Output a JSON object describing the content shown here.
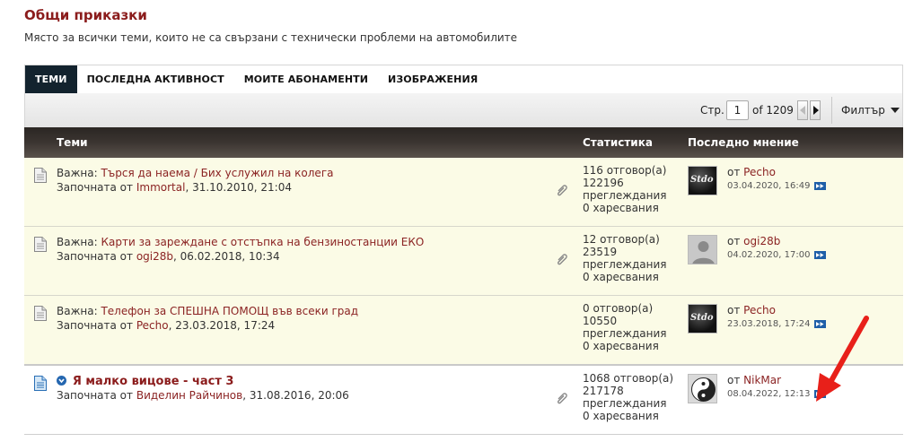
{
  "forum": {
    "title": "Общи приказки",
    "description": "Място за всички теми, които не са свързани с технически проблеми на автомобилите"
  },
  "tabs": [
    {
      "label": "ТЕМИ",
      "active": true
    },
    {
      "label": "ПОСЛЕДНА АКТИВНОСТ",
      "active": false
    },
    {
      "label": "МОИТЕ АБОНАМЕНТИ",
      "active": false
    },
    {
      "label": "ИЗОБРАЖЕНИЯ",
      "active": false
    }
  ],
  "pager": {
    "label": "Стр.",
    "current": "1",
    "total": "of 1209",
    "filter_label": "Филтър"
  },
  "table_header": {
    "topics": "Теми",
    "stats": "Статистика",
    "last_post": "Последно мнение"
  },
  "threads": [
    {
      "prefix": "Важна:",
      "title": "Търся да наема / Бих услужил на колега",
      "started_by_label": "Започната от",
      "author": "Immortal",
      "started_date": ", 31.10.2010, 21:04",
      "replies": "116 отговор(а)",
      "views_count": "122196",
      "views_label": "преглеждания",
      "likes": "0 харесвания",
      "last_by_label": "от",
      "last_user": "Pecho",
      "last_date": "03.04.2020, 16:49",
      "avatar": "stdo"
    },
    {
      "prefix": "Важна:",
      "title": "Карти за зареждане с отстъпка на бензиностанции ЕКО",
      "started_by_label": "Започната от",
      "author": "ogi28b",
      "started_date": ", 06.02.2018, 10:34",
      "replies": "12 отговор(а)",
      "views_count": "23519",
      "views_label": "преглеждания",
      "likes": "0 харесвания",
      "last_by_label": "от",
      "last_user": "ogi28b",
      "last_date": "04.02.2020, 17:00",
      "avatar": "default"
    },
    {
      "prefix": "Важна:",
      "title": "Телефон за СПЕШНА ПОМОЩ във всеки град",
      "started_by_label": "Започната от",
      "author": "Pecho",
      "started_date": ", 23.03.2018, 17:24",
      "replies": "0 отговор(а)",
      "views_count": "10550",
      "views_label": "преглеждания",
      "likes": "0 харесвания",
      "last_by_label": "от",
      "last_user": "Pecho",
      "last_date": "23.03.2018, 17:24",
      "avatar": "stdo"
    },
    {
      "prefix": "",
      "title": "Я малко вицове - част 3",
      "started_by_label": "Започната от",
      "author": "Виделин Райчинов",
      "started_date": ", 31.08.2016, 20:06",
      "replies": "1068 отговор(а)",
      "views_count": "217178",
      "views_label": "преглеждания",
      "likes": "0 харесвания",
      "last_by_label": "от",
      "last_user": "NikMar",
      "last_date": "08.04.2022, 12:13",
      "avatar": "yinyang"
    }
  ],
  "avatar_text": "Stdo",
  "colors": {
    "title": "#8b1c1c",
    "link": "#8b2323",
    "sticky_bg": "#fbfbe6",
    "header_dark": "#2a2623",
    "tab_active": "#13232e",
    "goto_icon": "#1f5fa8",
    "annotation_arrow": "#e8201a"
  }
}
